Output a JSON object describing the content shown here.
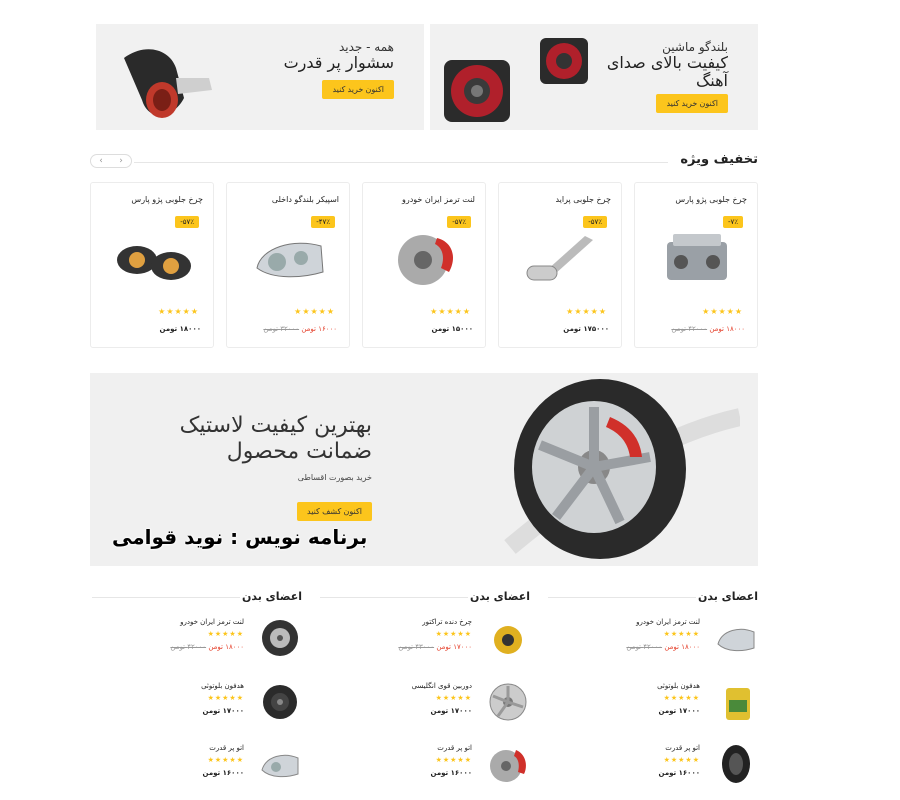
{
  "banners": [
    {
      "subtitle": "همه - جدید",
      "title": "سشوار پر قدرت",
      "button": "اکنون خرید کنید"
    },
    {
      "subtitle": "بلندگو ماشین",
      "title": "کیفیت بالای صدای آهنگ",
      "button": "اکنون خرید کنید"
    }
  ],
  "special": {
    "title": "تخفیف ویژه",
    "prev": "‹",
    "next": "›"
  },
  "products": [
    {
      "name": "چرخ جلوبی پژو پارس",
      "discount": "-۵۷٪",
      "stars": "★★★★★",
      "price": "۱۸۰۰۰ تومن",
      "old_price": ""
    },
    {
      "name": "اسپیکر بلندگو داخلی",
      "discount": "-۴۷٪",
      "stars": "★★★★★",
      "price": "۱۶۰۰۰ تومن",
      "old_price": "۳۲۰۰۰ تومن"
    },
    {
      "name": "لنت ترمز ایران خودرو",
      "discount": "-۵۷٪",
      "stars": "★★★★★",
      "price": "۱۵۰۰۰ تومن",
      "old_price": ""
    },
    {
      "name": "چرخ جلوبی پراید",
      "discount": "-۵۷٪",
      "stars": "★★★★★",
      "price": "۱۷۵۰۰۰ تومن",
      "old_price": ""
    },
    {
      "name": "چرخ جلوبی پژو پارس",
      "discount": "-۷٪",
      "stars": "★★★★★",
      "price": "۱۸۰۰۰ تومن",
      "old_price": "۴۲۰۰۰ تومن"
    }
  ],
  "hero": {
    "line1": "بهترین کیفیت لاستیک",
    "line2": "ضمانت محصول",
    "small": "خرید بصورت اقساطی",
    "button": "اکنون کشف کنید",
    "watermark": "برنامه نویس : نوید قوامی"
  },
  "columns": [
    {
      "title": "اعضای بدن",
      "items": [
        {
          "name": "لنت ترمز ایران خودرو",
          "stars": "★★★★★",
          "price": "۱۸۰۰۰ تومن",
          "old": "۴۲۰۰۰ تومن"
        },
        {
          "name": "هدفون بلوتوثی",
          "stars": "★★★★★",
          "price": "۱۷۰۰۰ تومن",
          "old": ""
        },
        {
          "name": "اتو پر قدرت",
          "stars": "★★★★★",
          "price": "۱۶۰۰۰ تومن",
          "old": ""
        }
      ]
    },
    {
      "title": "اعضای بدن",
      "items": [
        {
          "name": "چرخ دنده تراکتور",
          "stars": "★★★★★",
          "price": "۱۷۰۰۰ تومن",
          "old": "۴۳۰۰۰ تومن"
        },
        {
          "name": "دوربین قوی انگلیسی",
          "stars": "★★★★★",
          "price": "۱۷۰۰۰ تومن",
          "old": ""
        },
        {
          "name": "اتو پر قدرت",
          "stars": "★★★★★",
          "price": "۱۶۰۰۰ تومن",
          "old": ""
        }
      ]
    },
    {
      "title": "اعضای بدن",
      "items": [
        {
          "name": "لنت ترمز ایران خودرو",
          "stars": "★★★★★",
          "price": "۱۸۰۰۰ تومن",
          "old": "۴۲۰۰۰ تومن"
        },
        {
          "name": "هدفون بلوتوثی",
          "stars": "★★★★★",
          "price": "۱۷۰۰۰ تومن",
          "old": ""
        },
        {
          "name": "اتو پر قدرت",
          "stars": "★★★★★",
          "price": "۱۶۰۰۰ تومن",
          "old": ""
        }
      ]
    }
  ]
}
